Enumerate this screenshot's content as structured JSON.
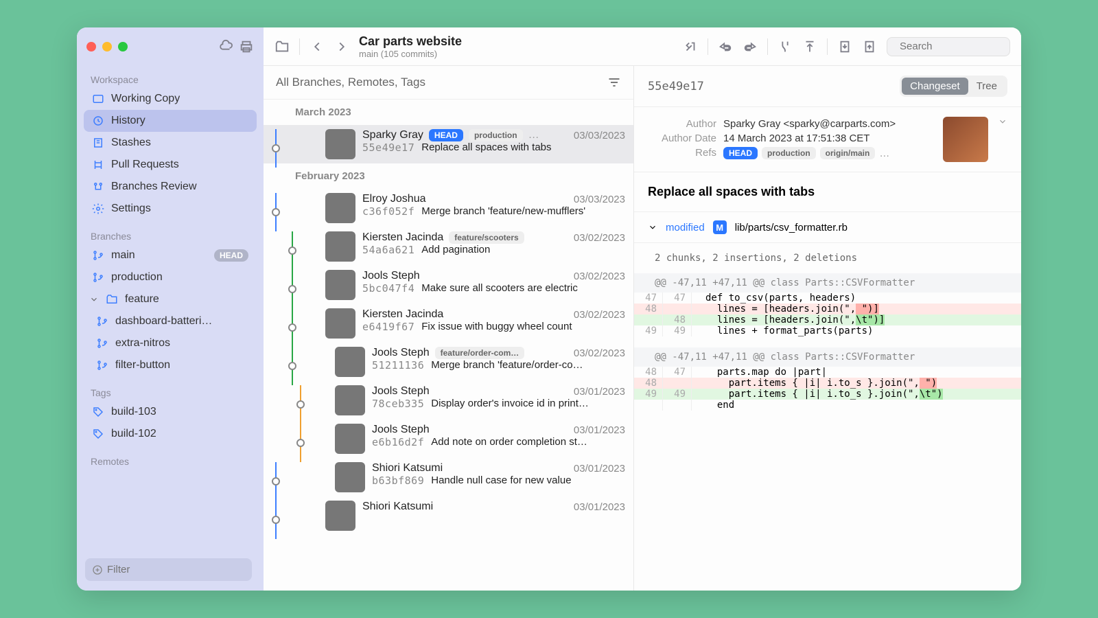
{
  "project": {
    "title": "Car parts website",
    "subtitle": "main (105 commits)"
  },
  "search_placeholder": "Search",
  "sidebar": {
    "workspace_label": "Workspace",
    "workspace": [
      {
        "label": "Working Copy"
      },
      {
        "label": "History"
      },
      {
        "label": "Stashes"
      },
      {
        "label": "Pull Requests"
      },
      {
        "label": "Branches Review"
      },
      {
        "label": "Settings"
      }
    ],
    "branches_label": "Branches",
    "branches": [
      {
        "label": "main",
        "head": "HEAD"
      },
      {
        "label": "production"
      },
      {
        "label": "feature",
        "folder": true,
        "children": [
          {
            "label": "dashboard-batteri…"
          },
          {
            "label": "extra-nitros"
          },
          {
            "label": "filter-button"
          }
        ]
      }
    ],
    "tags_label": "Tags",
    "tags": [
      {
        "label": "build-103"
      },
      {
        "label": "build-102"
      }
    ],
    "remotes_label": "Remotes",
    "filter_placeholder": "Filter"
  },
  "history": {
    "filter_label": "All Branches, Remotes, Tags",
    "groups": [
      {
        "month": "March 2023",
        "commits": [
          {
            "author": "Sparky Gray",
            "date": "03/03/2023",
            "sha": "55e49e17",
            "msg": "Replace all spaces with tabs",
            "refs": [
              "HEAD",
              "production"
            ],
            "more": "…",
            "av": "av-a",
            "sel": true,
            "lane": 1
          }
        ]
      },
      {
        "month": "February 2023",
        "commits": [
          {
            "author": "Elroy Joshua",
            "date": "03/03/2023",
            "sha": "c36f052f",
            "msg": "Merge branch 'feature/new-mufflers'",
            "av": "av-b",
            "lane": 1
          },
          {
            "author": "Kiersten Jacinda",
            "date": "03/02/2023",
            "sha": "54a6a621",
            "msg": "Add pagination",
            "refs2": "feature/scooters",
            "av": "av-c",
            "lane": 3
          },
          {
            "author": "Jools Steph",
            "date": "03/02/2023",
            "sha": "5bc047f4",
            "msg": "Make sure all scooters are electric",
            "av": "av-d",
            "lane": 3
          },
          {
            "author": "Kiersten Jacinda",
            "date": "03/02/2023",
            "sha": "e6419f67",
            "msg": "Fix issue with buggy wheel count",
            "av": "av-c",
            "lane": 3
          },
          {
            "author": "Jools Steph",
            "date": "03/02/2023",
            "sha": "51211136",
            "msg": "Merge branch 'feature/order-co…",
            "refs2": "feature/order-com…",
            "av": "av-d",
            "lane": 3,
            "gap": 1
          },
          {
            "author": "Jools Steph",
            "date": "03/01/2023",
            "sha": "78ceb335",
            "msg": "Display order's invoice id in print…",
            "av": "av-d",
            "lane": 4,
            "gap": 1
          },
          {
            "author": "Jools Steph",
            "date": "03/01/2023",
            "sha": "e6b16d2f",
            "msg": "Add note on order completion st…",
            "av": "av-d",
            "lane": 4,
            "gap": 1
          },
          {
            "author": "Shiori Katsumi",
            "date": "03/01/2023",
            "sha": "b63bf869",
            "msg": "Handle null case for new value",
            "av": "av-e",
            "lane": 1,
            "gap": 1
          },
          {
            "author": "Shiori Katsumi",
            "date": "03/01/2023",
            "sha": "",
            "msg": "",
            "av": "av-e",
            "lane": 1
          }
        ]
      }
    ]
  },
  "detail": {
    "sha": "55e49e17",
    "toggle_changeset": "Changeset",
    "toggle_tree": "Tree",
    "author_k": "Author",
    "author_v": "Sparky Gray <sparky@carparts.com>",
    "date_k": "Author Date",
    "date_v": "14 March 2023 at 17:51:38 CET",
    "refs_k": "Refs",
    "refs": [
      "HEAD",
      "production",
      "origin/main"
    ],
    "refs_more": "…",
    "title": "Replace all spaces with tabs",
    "file_status": "modified",
    "file_badge": "M",
    "file_path": "lib/parts/csv_formatter.rb",
    "summary": "2 chunks, 2 insertions, 2 deletions",
    "hunks": [
      {
        "header": "@@ -47,11 +47,11 @@ class Parts::CSVFormatter",
        "lines": [
          {
            "a": "47",
            "b": "47",
            "t": " ",
            "c": "def to_csv(parts, headers)"
          },
          {
            "a": "48",
            "b": "",
            "t": "-",
            "c": "  lines = [headers.join(\",",
            "h": " \")]"
          },
          {
            "a": "",
            "b": "48",
            "t": "+",
            "c": "  lines = [headers.join(\",",
            "h": "\\t\")]"
          },
          {
            "a": "49",
            "b": "49",
            "t": " ",
            "c": "  lines + format_parts(parts)"
          }
        ]
      },
      {
        "header": "@@ -47,11 +47,11 @@ class Parts::CSVFormatter",
        "lines": [
          {
            "a": "48",
            "b": "47",
            "t": " ",
            "c": "  parts.map do |part|"
          },
          {
            "a": "48",
            "b": "",
            "t": "-",
            "c": "    part.items { |i| i.to_s }.join(\",",
            "h": " \")"
          },
          {
            "a": "49",
            "b": "49",
            "t": "+",
            "c": "    part.items { |i| i.to_s }.join(\",",
            "h": "\\t\")"
          },
          {
            "a": "",
            "b": "",
            "t": " ",
            "c": "  end"
          }
        ]
      }
    ]
  }
}
